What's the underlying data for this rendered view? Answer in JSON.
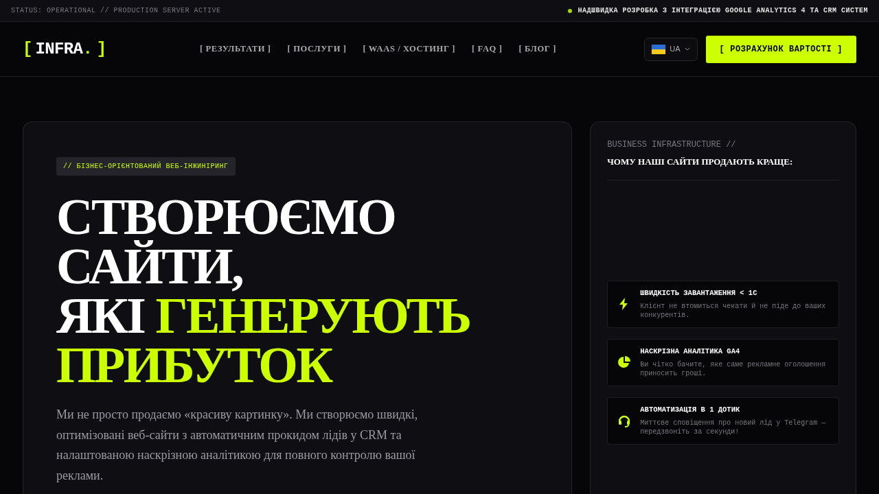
{
  "status_bar": {
    "left": "STATUS: OPERATIONAL // PRODUCTION SERVER ACTIVE",
    "right": "НАДШВИДКА РОЗРОБКА З ІНТЕГРАЦІЄЮ GOOGLE ANALYTICS 4 ТА CRM СИСТЕМ"
  },
  "header": {
    "logo": {
      "open": "[",
      "name": "INFRA",
      "dot": ".",
      "close": "]"
    },
    "nav": [
      "[ РЕЗУЛЬТАТИ ]",
      "[ ПОСЛУГИ ]",
      "[ WAAS / ХОСТИНГ ]",
      "[ FAQ ]",
      "[ БЛОГ ]"
    ],
    "language": "UA",
    "cta": "[ РОЗРАХУНОК ВАРТОСТІ ]"
  },
  "hero": {
    "tag": "// БІЗНЕС-ОРІЄНТОВАНИЙ ВЕБ-ІНЖИНІРИНГ",
    "headline": [
      [
        {
          "text": "СТВОРЮЄМО",
          "accent": false
        }
      ],
      [
        {
          "text": "САЙТИ,",
          "accent": false
        }
      ],
      [
        {
          "text": "ЯКІ ",
          "accent": false
        },
        {
          "text": "ГЕНЕРУЮТЬ",
          "accent": true
        }
      ],
      [
        {
          "text": "ПРИБУТОК",
          "accent": true
        }
      ]
    ],
    "description": "Ми не просто продаємо «красиву картинку». Ми створюємо швидкі, оптимізовані веб-сайти з автоматичним прокидом лідів у CRM та налаштованою наскрізною аналітикою для повного контролю вашої реклами."
  },
  "benefits": {
    "eyebrow": "BUSINESS INFRASTRUCTURE //",
    "title": "ЧОМУ НАШІ САЙТИ ПРОДАЮТЬ КРАЩЕ:",
    "items": [
      {
        "kind": "bolt",
        "title": "ШВИДКІСТЬ ЗАВАНТАЖЕННЯ < 1С",
        "text": "Клієнт не втомиться чекати й не піде до ваших конкурентів."
      },
      {
        "kind": "pie",
        "title": "НАСКРІЗНА АНАЛІТИКА GA4",
        "text": "Ви чітко бачите, яке саме рекламне оголошення приносить гроші."
      },
      {
        "kind": "headset",
        "title": "АВТОМАТИЗАЦІЯ В 1 ДОТИК",
        "text": "Миттєве сповіщення про новий лід у Telegram — передзвоніть за секунди!"
      }
    ]
  }
}
